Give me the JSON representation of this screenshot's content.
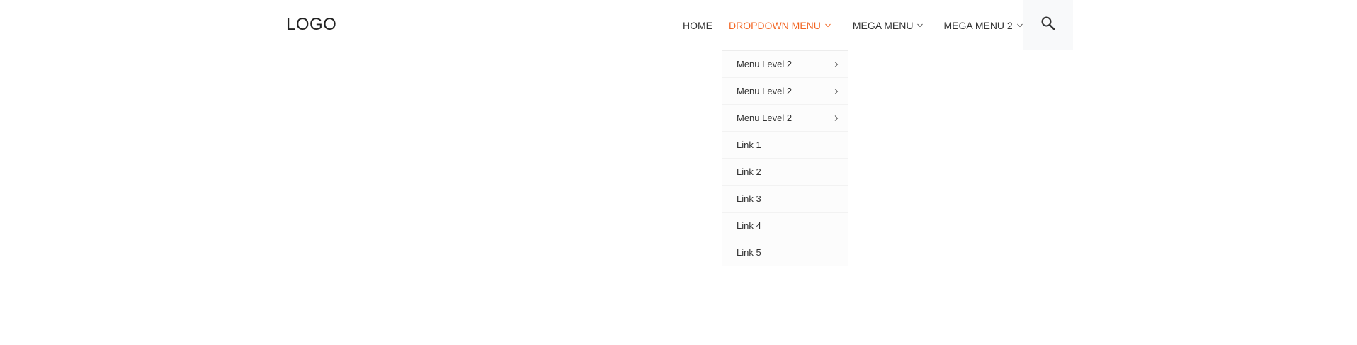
{
  "header": {
    "logo": "LOGO"
  },
  "nav": {
    "items": [
      {
        "label": "HOME",
        "icon": null
      },
      {
        "label": "DROPDOWN MENU",
        "icon": "chevron-down-icon"
      },
      {
        "label": "MEGA MENU",
        "icon": "chevron-down-icon"
      },
      {
        "label": "MEGA MENU 2",
        "icon": "chevron-down-icon"
      }
    ],
    "active_color": "#f26522",
    "search_icon": "search-icon"
  },
  "dropdown": {
    "items": [
      {
        "label": "Menu Level 2",
        "icon": "chevron-right-icon"
      },
      {
        "label": "Menu Level 2",
        "icon": "chevron-right-icon"
      },
      {
        "label": "Menu Level 2",
        "icon": "chevron-right-icon"
      },
      {
        "label": "Link 1"
      },
      {
        "label": "Link 2"
      },
      {
        "label": "Link 3"
      },
      {
        "label": "Link 4"
      },
      {
        "label": "Link 5"
      }
    ]
  }
}
